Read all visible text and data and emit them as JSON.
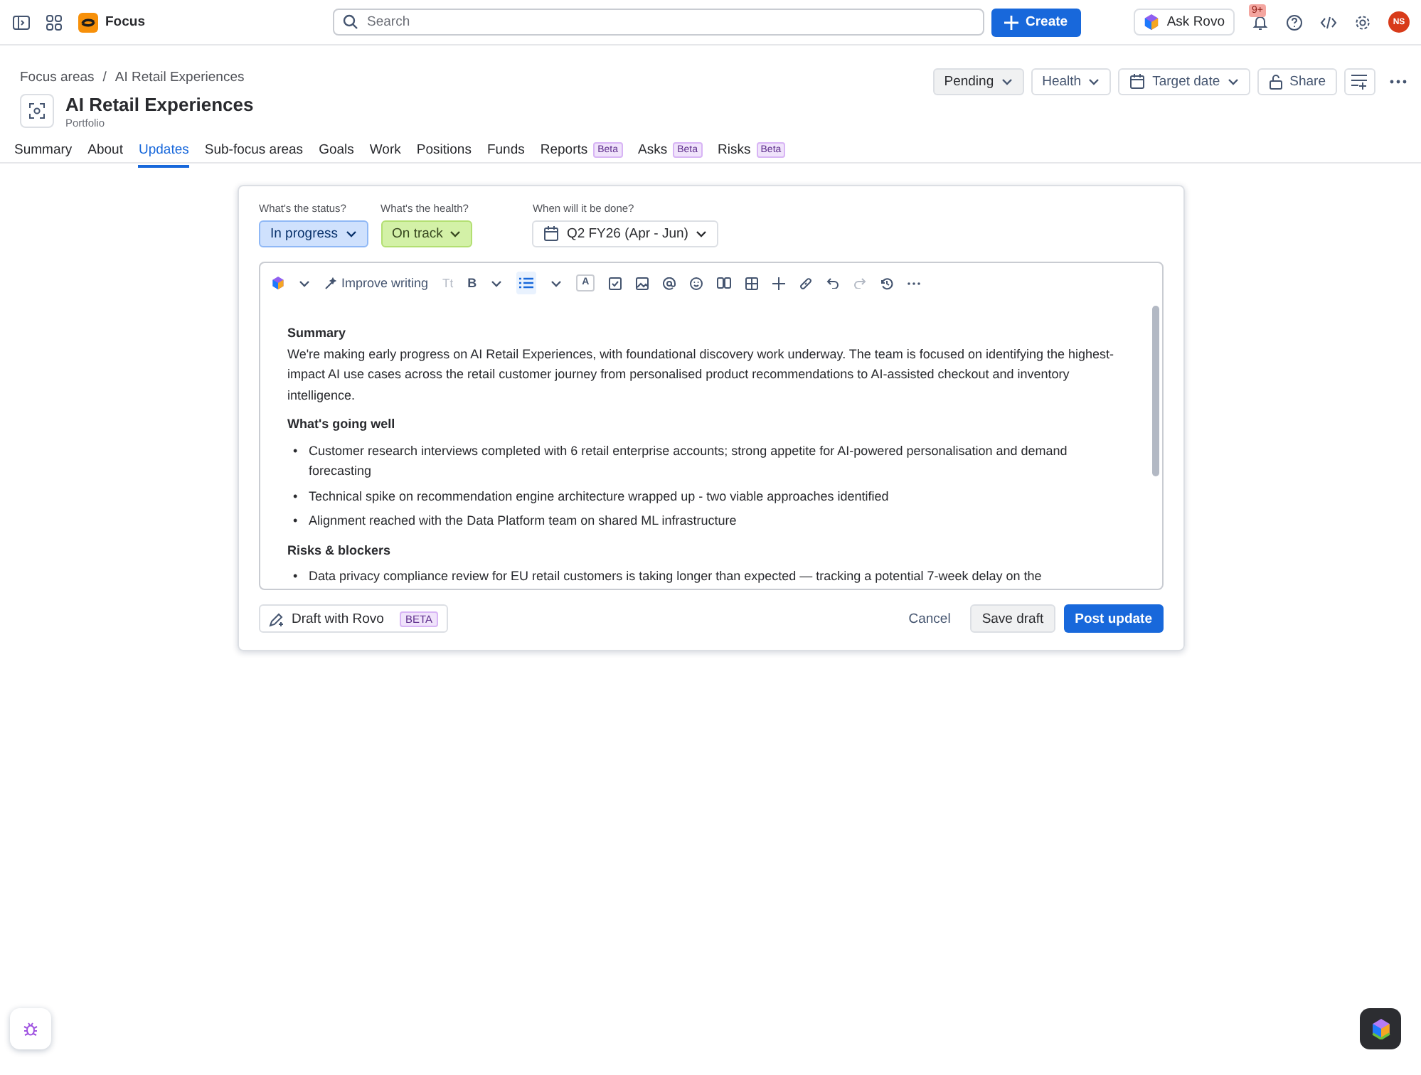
{
  "topbar": {
    "product": "Focus",
    "search": {
      "placeholder": "Search"
    },
    "create": "Create",
    "ask_rovo": "Ask Rovo",
    "notification_count": "9+",
    "avatar": "NS"
  },
  "header": {
    "breadcrumbs": [
      "Focus areas",
      "AI Retail Experiences"
    ],
    "breadcrumb_separator": "/",
    "title": "AI Retail Experiences",
    "subtitle": "Portfolio",
    "actions": [
      {
        "label": "Pending",
        "kind": "status"
      },
      {
        "label": "Health",
        "kind": "dropdown"
      },
      {
        "label": "Target date",
        "kind": "date"
      },
      {
        "label": "Share",
        "kind": "share"
      }
    ]
  },
  "tabs": [
    {
      "label": "Summary",
      "selected": false
    },
    {
      "label": "About",
      "selected": false
    },
    {
      "label": "Updates",
      "selected": true
    },
    {
      "label": "Sub-focus areas",
      "selected": false
    },
    {
      "label": "Goals",
      "selected": false
    },
    {
      "label": "Work",
      "selected": false
    },
    {
      "label": "Positions",
      "selected": false
    },
    {
      "label": "Funds",
      "selected": false
    },
    {
      "label": "Reports",
      "badge": "Beta",
      "selected": false
    },
    {
      "label": "Asks",
      "badge": "Beta",
      "selected": false
    },
    {
      "label": "Risks",
      "badge": "Beta",
      "selected": false
    }
  ],
  "update_form": {
    "fields": [
      {
        "label": "What's the status?",
        "value": "In progress",
        "kind": "status"
      },
      {
        "label": "What's the health?",
        "value": "On track",
        "kind": "health"
      },
      {
        "label": "When will it be done?",
        "value": "Q2 FY26 (Apr - Jun)",
        "kind": "date"
      }
    ],
    "toolbar": {
      "improve_writing": "Improve writing",
      "text_style": "Tt",
      "bold": "B",
      "text_color": "A"
    },
    "content": [
      {
        "kind": "heading",
        "text": "Summary"
      },
      {
        "kind": "paragraph",
        "text": "We're making early progress on AI Retail Experiences, with foundational discovery work underway. The team is focused on identifying the highest-impact AI use cases across the retail customer journey from personalised product recommendations to AI-assisted checkout and inventory intelligence."
      },
      {
        "kind": "heading",
        "text": "What's going well"
      },
      {
        "kind": "bullets",
        "bullet": "•",
        "items": [
          "Customer research interviews completed with 6 retail enterprise accounts; strong appetite for AI-powered personalisation and demand forecasting",
          "Technical spike on recommendation engine architecture wrapped up - two viable approaches identified",
          "Alignment reached with the Data Platform team on shared ML infrastructure"
        ]
      },
      {
        "kind": "heading",
        "text": "Risks & blockers"
      },
      {
        "kind": "bullets",
        "bullet": "•",
        "items": [
          "Data privacy compliance review for EU retail customers is taking longer than expected — tracking a potential 7-week delay on the"
        ]
      }
    ],
    "draft_with_rovo": "Draft with Rovo",
    "draft_badge": "BETA",
    "cancel": "Cancel",
    "save_draft": "Save draft",
    "post_update": "Post update"
  }
}
